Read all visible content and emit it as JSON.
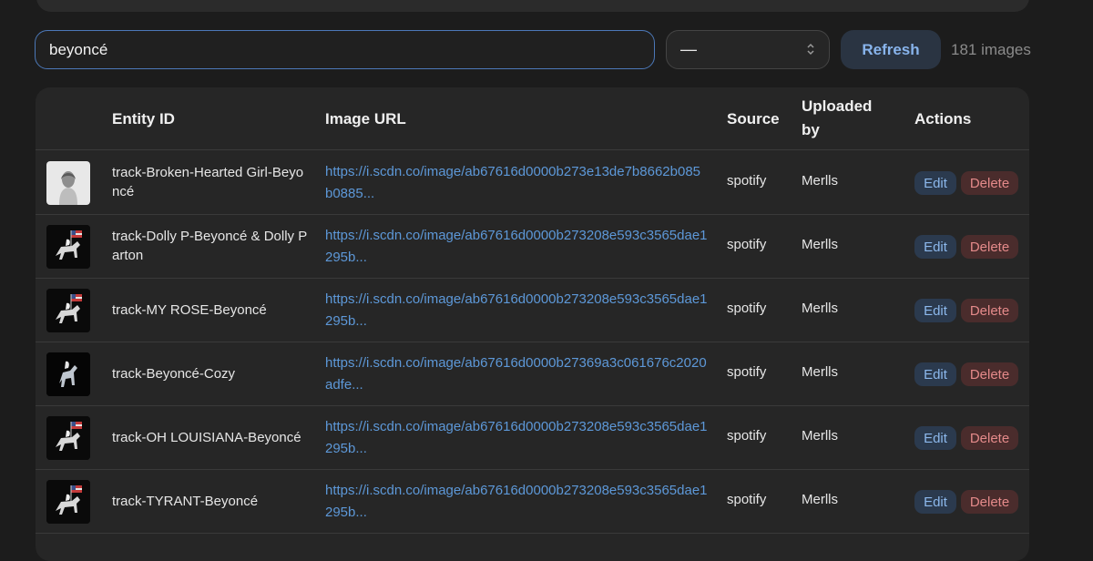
{
  "search": {
    "value": "beyoncé"
  },
  "filter": {
    "selected": "—"
  },
  "refresh_label": "Refresh",
  "count_label": "181 images",
  "table": {
    "headers": {
      "entity_id": "Entity ID",
      "image_url": "Image URL",
      "source": "Source",
      "uploaded_by": "Uploaded by",
      "actions": "Actions"
    },
    "rows": [
      {
        "entity_id": "track-Broken-Hearted Girl-Beyoncé",
        "image_url": "https://i.scdn.co/image/ab67616d0000b273e13de7b8662b085b0885...",
        "source": "spotify",
        "uploaded_by": "Merlls",
        "thumb": "portrait"
      },
      {
        "entity_id": "track-Dolly P-Beyoncé & Dolly Parton",
        "image_url": "https://i.scdn.co/image/ab67616d0000b273208e593c3565dae1295b...",
        "source": "spotify",
        "uploaded_by": "Merlls",
        "thumb": "horse"
      },
      {
        "entity_id": "track-MY ROSE-Beyoncé",
        "image_url": "https://i.scdn.co/image/ab67616d0000b273208e593c3565dae1295b...",
        "source": "spotify",
        "uploaded_by": "Merlls",
        "thumb": "horse"
      },
      {
        "entity_id": "track-Beyoncé-Cozy",
        "image_url": "https://i.scdn.co/image/ab67616d0000b27369a3c061676c2020adfe...",
        "source": "spotify",
        "uploaded_by": "Merlls",
        "thumb": "silver-horse"
      },
      {
        "entity_id": "track-OH LOUISIANA-Beyoncé",
        "image_url": "https://i.scdn.co/image/ab67616d0000b273208e593c3565dae1295b...",
        "source": "spotify",
        "uploaded_by": "Merlls",
        "thumb": "horse"
      },
      {
        "entity_id": "track-TYRANT-Beyoncé",
        "image_url": "https://i.scdn.co/image/ab67616d0000b273208e593c3565dae1295b...",
        "source": "spotify",
        "uploaded_by": "Merlls",
        "thumb": "horse"
      }
    ],
    "edit_label": "Edit",
    "delete_label": "Delete"
  },
  "colors": {
    "accent": "#5d98d8",
    "delete": "#e48a8a",
    "background": "#1c1c1c",
    "panel": "#262626"
  }
}
